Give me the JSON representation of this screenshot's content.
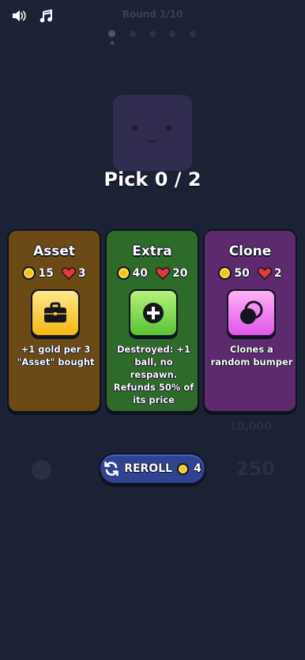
{
  "topbar": {
    "sound_icon": "speaker-icon",
    "music_icon": "music-note-icon"
  },
  "round": {
    "label": "Round 1/10"
  },
  "pick": {
    "title": "Pick 0 / 2"
  },
  "cards": [
    {
      "name": "Asset",
      "gold": "15",
      "hearts": "3",
      "icon": "briefcase-icon",
      "description": "+1 gold per 3 \"Asset\" bought"
    },
    {
      "name": "Extra",
      "gold": "40",
      "hearts": "20",
      "icon": "plus-ball-icon",
      "description": "Destroyed: +1 ball, no respawn. Refunds 50% of its price"
    },
    {
      "name": "Clone",
      "gold": "50",
      "hearts": "2",
      "icon": "bumper-clone-icon",
      "description": "Clones a random bumper"
    }
  ],
  "background": {
    "score": "10,000",
    "points": "250"
  },
  "reroll": {
    "label": "REROLL",
    "cost": "4"
  },
  "colors": {
    "background": "#1c2236",
    "asset_card": "#6b4a16",
    "extra_card": "#2e6a2a",
    "clone_card": "#5e2a6e",
    "reroll_button": "#2f4390",
    "coin": "#f4c21b",
    "heart": "#e53a3a"
  }
}
